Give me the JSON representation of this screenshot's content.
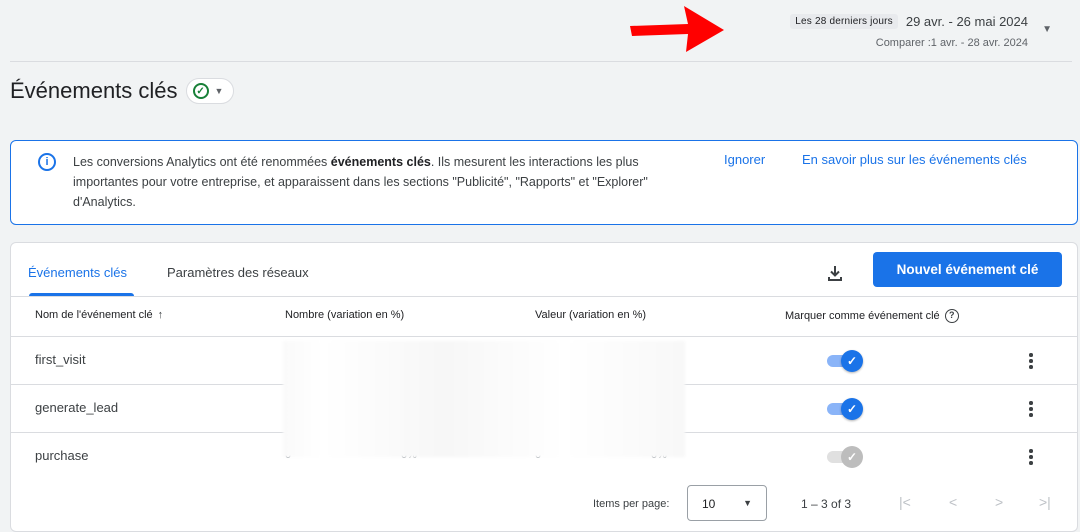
{
  "date_range": {
    "preset_label": "Les 28 derniers jours",
    "range": "29 avr. - 26 mai 2024",
    "compare": "Comparer :1 avr. - 28 avr. 2024"
  },
  "page": {
    "title": "Événements clés"
  },
  "banner": {
    "text_before": "Les conversions Analytics ont été renommées ",
    "text_bold": "événements clés",
    "text_after": ". Ils mesurent les interactions les plus importantes pour votre entreprise, et apparaissent dans les sections \"Publicité\", \"Rapports\" et \"Explorer\" d'Analytics.",
    "dismiss_label": "Ignorer",
    "learn_more_label": "En savoir plus sur les événements clés"
  },
  "tabs": [
    {
      "label": "Événements clés",
      "active": true
    },
    {
      "label": "Paramètres des réseaux",
      "active": false
    }
  ],
  "toolbar": {
    "new_button_label": "Nouvel événement clé"
  },
  "table": {
    "columns": [
      "Nom de l'événement clé",
      "Nombre (variation en %)",
      "Valeur (variation en %)",
      "Marquer comme événement clé"
    ],
    "rows": [
      {
        "name": "first_visit",
        "marked": true
      },
      {
        "name": "generate_lead",
        "marked": true
      },
      {
        "name": "purchase",
        "marked": false
      }
    ],
    "peek": [
      "0",
      "0%",
      "0",
      "0%"
    ]
  },
  "pagination": {
    "items_per_page_label": "Items per page:",
    "items_per_page_value": "10",
    "range_label": "1 – 3 of 3"
  },
  "colors": {
    "accent": "#1a73e8",
    "annotation_arrow": "#ff0000",
    "success": "#188038"
  },
  "icons": [
    "red-arrow-annotation",
    "dropdown-caret-icon",
    "check-circle-icon",
    "info-icon",
    "download-icon",
    "sort-arrow-up-icon",
    "help-icon",
    "more-vert-icon",
    "first-page-icon",
    "prev-page-icon",
    "next-page-icon",
    "last-page-icon"
  ]
}
